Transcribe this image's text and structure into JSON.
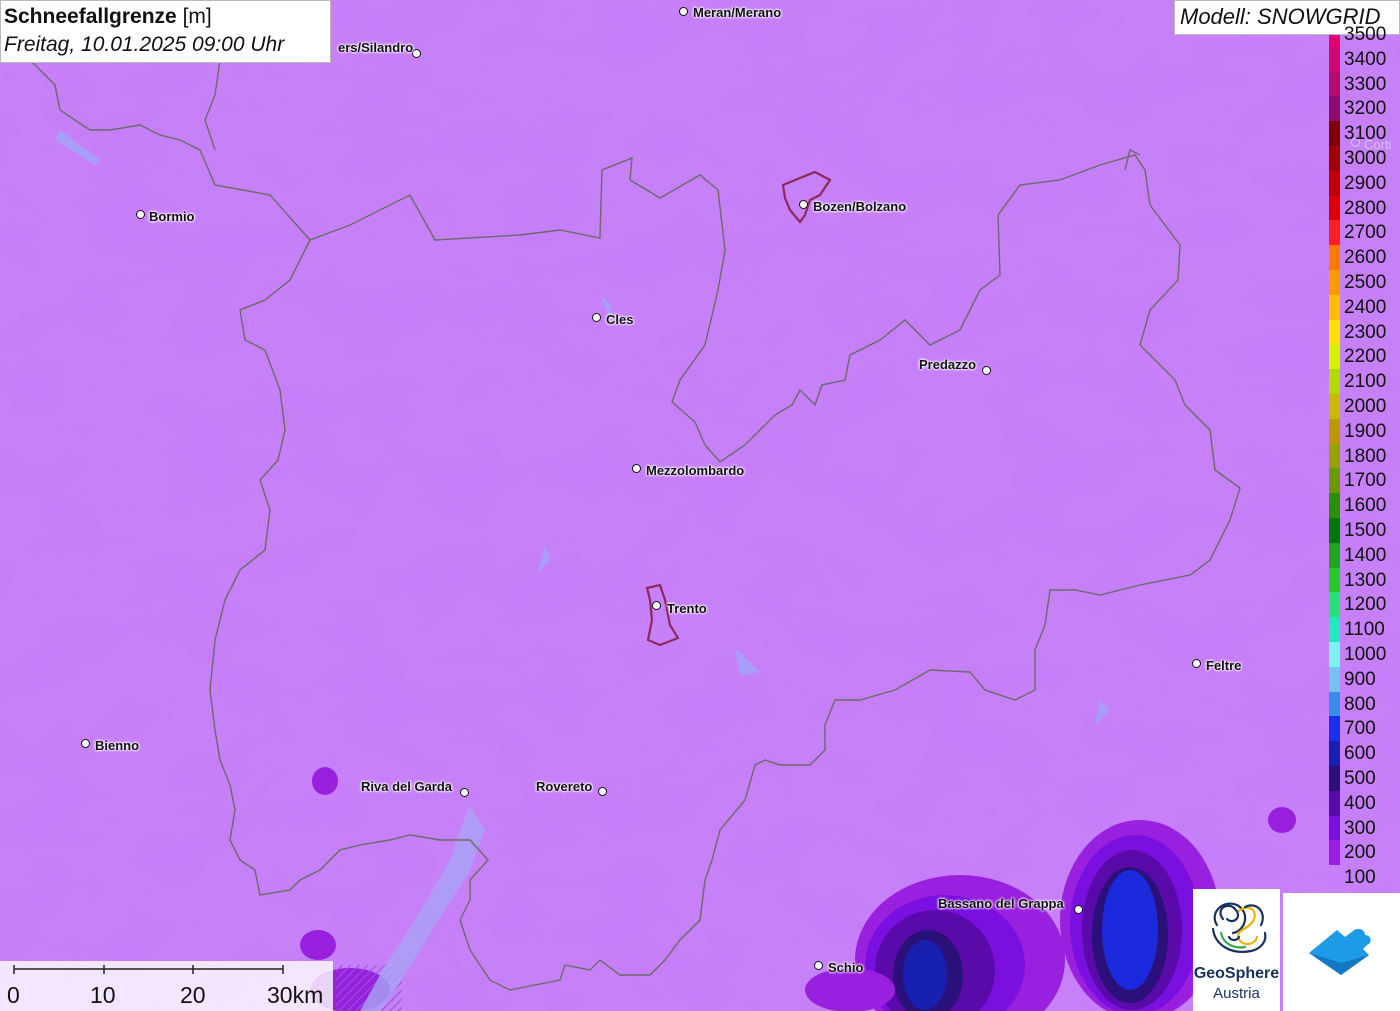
{
  "title": {
    "name": "Schneefallgrenze",
    "unit": "[m]",
    "datetime": "Freitag, 10.01.2025 09:00 Uhr"
  },
  "model": "Modell: SNOWGRID",
  "legend": [
    {
      "label": "3500",
      "color": "#e0007a"
    },
    {
      "label": "3400",
      "color": "#cc0a6f"
    },
    {
      "label": "3300",
      "color": "#b00c72"
    },
    {
      "label": "3200",
      "color": "#8f0b70"
    },
    {
      "label": "3100",
      "color": "#800000"
    },
    {
      "label": "3000",
      "color": "#a00000"
    },
    {
      "label": "2900",
      "color": "#c00000"
    },
    {
      "label": "2800",
      "color": "#e00000"
    },
    {
      "label": "2700",
      "color": "#ff2020"
    },
    {
      "label": "2600",
      "color": "#ff7a00"
    },
    {
      "label": "2500",
      "color": "#ff9a00"
    },
    {
      "label": "2400",
      "color": "#ffbb00"
    },
    {
      "label": "2300",
      "color": "#ffe000"
    },
    {
      "label": "2200",
      "color": "#d7f000"
    },
    {
      "label": "2100",
      "color": "#b5d800"
    },
    {
      "label": "2000",
      "color": "#c9b800"
    },
    {
      "label": "1900",
      "color": "#bb9800"
    },
    {
      "label": "1800",
      "color": "#99a000"
    },
    {
      "label": "1700",
      "color": "#6a9a00"
    },
    {
      "label": "1600",
      "color": "#2e8f00"
    },
    {
      "label": "1500",
      "color": "#007a00"
    },
    {
      "label": "1400",
      "color": "#1aa81a"
    },
    {
      "label": "1300",
      "color": "#22cc22"
    },
    {
      "label": "1200",
      "color": "#22e07a"
    },
    {
      "label": "1100",
      "color": "#22e8c0"
    },
    {
      "label": "1000",
      "color": "#77f5f5"
    },
    {
      "label": "900",
      "color": "#77c0f0"
    },
    {
      "label": "800",
      "color": "#3a8ae8"
    },
    {
      "label": "700",
      "color": "#1a2ff0"
    },
    {
      "label": "600",
      "color": "#1820b0"
    },
    {
      "label": "500",
      "color": "#2a1078"
    },
    {
      "label": "400",
      "color": "#5a0aa8"
    },
    {
      "label": "300",
      "color": "#7a10e0"
    },
    {
      "label": "200",
      "color": "#9a20e0"
    },
    {
      "label": "100",
      "color": "#c77ef9"
    }
  ],
  "cities": [
    {
      "name": "Meran/Merano"
    },
    {
      "name": "ers/Silandro"
    },
    {
      "name": "Bormio"
    },
    {
      "name": "Bozen/Bolzano"
    },
    {
      "name": "Cles"
    },
    {
      "name": "Predazzo"
    },
    {
      "name": "Mezzolombardo"
    },
    {
      "name": "Trento"
    },
    {
      "name": "Feltre"
    },
    {
      "name": "Bienno"
    },
    {
      "name": "Riva del Garda"
    },
    {
      "name": "Rovereto"
    },
    {
      "name": "Bassano del Grappa"
    },
    {
      "name": "Schio"
    },
    {
      "name": "Corti"
    }
  ],
  "scale": {
    "ticks": [
      "0",
      "10",
      "20",
      "30km"
    ]
  },
  "logos": {
    "geosphere_name": "GeoSphere",
    "geosphere_sub": "Austria"
  }
}
